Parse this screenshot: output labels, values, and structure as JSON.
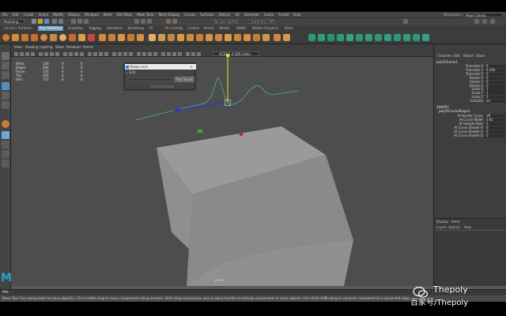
{
  "menubar": {
    "items": [
      "File",
      "Edit",
      "Create",
      "Select",
      "Modify",
      "Display",
      "Windows",
      "Mesh",
      "Edit Mesh",
      "Mesh Tools",
      "Mesh Display",
      "Curves",
      "Surfaces",
      "Deform",
      "UV",
      "Generate",
      "Cache",
      "Arnold",
      "Help"
    ],
    "workspace_label": "Workspace:",
    "workspace_value": "Maya Classic"
  },
  "statusline": {
    "mode": "Modeling",
    "live_surface": "No Live Surface",
    "symmetry": "Symmetry: Off"
  },
  "shelf": {
    "tabs": [
      "Curves / Surfaces",
      "Poly Modeling",
      "Sculpting",
      "Rigging",
      "Animation",
      "Rendering",
      "FX",
      "FX Caching",
      "Custom",
      "Arnold",
      "Bifrost",
      "MASH",
      "Motion Graphics",
      "XGen"
    ],
    "active_tab_index": 1
  },
  "viewport": {
    "menu": [
      "View",
      "Shading",
      "Lighting",
      "Show",
      "Renderer",
      "Panels"
    ],
    "camera": "persp",
    "camera_select": "ACES 1.0 SDR-video",
    "hud": [
      {
        "label": "Verts:",
        "a": "136",
        "b": "0",
        "c": "0"
      },
      {
        "label": "Edges:",
        "a": "264",
        "b": "0",
        "c": "0"
      },
      {
        "label": "Faces:",
        "a": "130",
        "b": "0",
        "c": "0"
      },
      {
        "label": "Tris:",
        "a": "256",
        "b": "0",
        "c": "0"
      },
      {
        "label": "UVs:",
        "a": "172",
        "b": "0",
        "c": "0"
      }
    ]
  },
  "dialog": {
    "title": "Shape Lock",
    "menu": "Edit",
    "button": "Run Script",
    "label": "Preview Shape"
  },
  "channelbox": {
    "tabs": [
      "Channels",
      "Edit",
      "Object",
      "Show"
    ],
    "object": "polyToCurve1",
    "attrs": [
      {
        "name": "Translate X",
        "value": "0"
      },
      {
        "name": "Translate Y",
        "value": "0.356"
      },
      {
        "name": "Translate Z",
        "value": "0"
      },
      {
        "name": "Rotate X",
        "value": "0"
      },
      {
        "name": "Rotate Y",
        "value": "0"
      },
      {
        "name": "Rotate Z",
        "value": "0"
      },
      {
        "name": "Scale X",
        "value": "1"
      },
      {
        "name": "Scale Y",
        "value": "1"
      },
      {
        "name": "Scale Z",
        "value": "1"
      },
      {
        "name": "Visibility",
        "value": "on"
      }
    ],
    "shapes_header": "SHAPES",
    "shape_name": "polyToCurveShape1",
    "shape_attrs": [
      {
        "name": "AI Render Curve",
        "value": "off"
      },
      {
        "name": "AI Curve Width",
        "value": "0.01"
      },
      {
        "name": "AI Sample Rate",
        "value": "5"
      },
      {
        "name": "AI Curve Shader R",
        "value": "0"
      },
      {
        "name": "AI Curve Shader G",
        "value": "0"
      },
      {
        "name": "AI Curve Shader B",
        "value": "0"
      }
    ]
  },
  "layers": {
    "tabs": [
      "Display",
      "Anim"
    ],
    "menu": [
      "Layers",
      "Options",
      "Help"
    ]
  },
  "bottom": {
    "cmd_label": "MEL",
    "help": "Move Tool: Use manipulator to move object(s). Ctrl+middle-drag to move components along normals. Shift+drag manipulator axis or plane handles to extrude components or clone objects. Ctrl+Shift+LMB+drag to constrain movement to a connected edge."
  },
  "watermark": {
    "en": "Thepoly",
    "cn": "百家号/Thepoly"
  }
}
